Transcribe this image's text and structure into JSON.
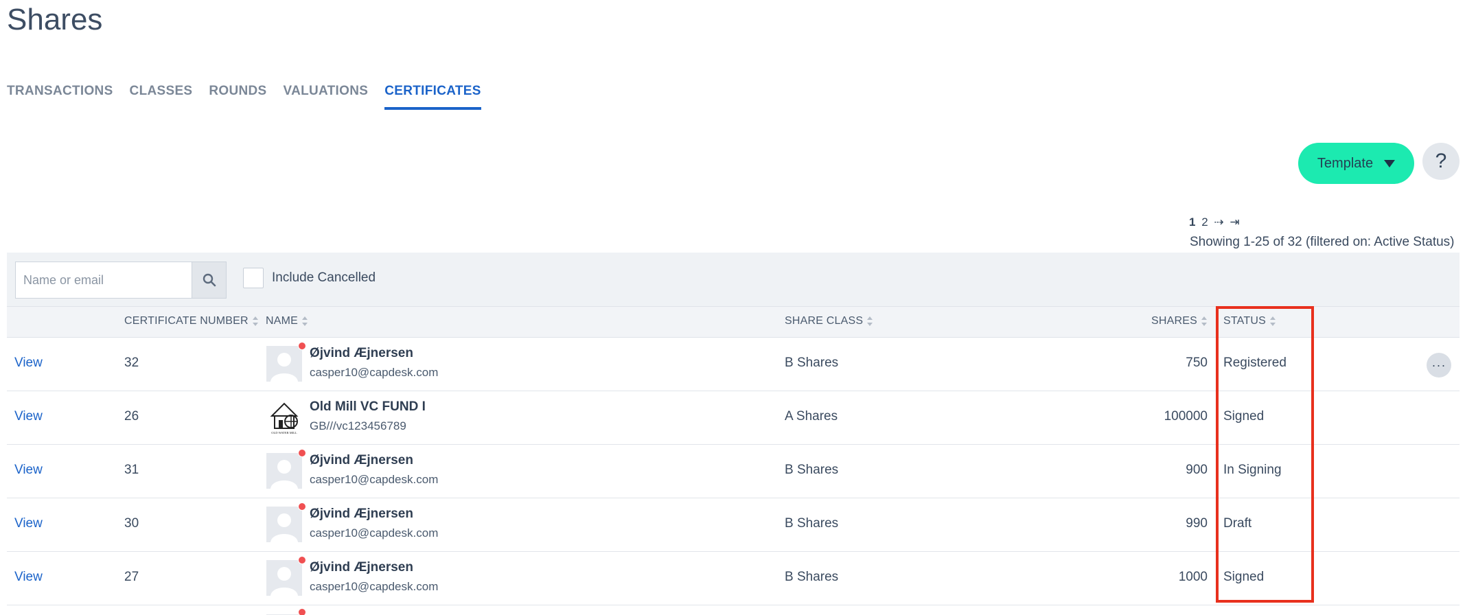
{
  "page": {
    "title": "Shares"
  },
  "tabs": [
    {
      "label": "TRANSACTIONS",
      "active": false
    },
    {
      "label": "CLASSES",
      "active": false
    },
    {
      "label": "ROUNDS",
      "active": false
    },
    {
      "label": "VALUATIONS",
      "active": false
    },
    {
      "label": "CERTIFICATES",
      "active": true
    }
  ],
  "toolbar": {
    "template_label": "Template",
    "help_label": "?"
  },
  "pagination": {
    "pages": [
      "1",
      "2"
    ],
    "current": "1",
    "next": "⇢",
    "last": "⇥",
    "summary": "Showing 1-25 of 32 (filtered on: Active Status)"
  },
  "filters": {
    "search_placeholder": "Name or email",
    "search_value": "",
    "include_cancelled_label": "Include Cancelled",
    "include_cancelled_checked": false
  },
  "table": {
    "columns": {
      "certificate_number": "CERTIFICATE NUMBER",
      "name": "NAME",
      "share_class": "SHARE CLASS",
      "shares": "SHARES",
      "status": "STATUS"
    },
    "rows": [
      {
        "action": "View",
        "certificate_number": "32",
        "name": "Øjvind Æjnersen",
        "sub": "casper10@capdesk.com",
        "avatar": "person-placeholder",
        "share_class": "B Shares",
        "shares": "750",
        "status": "Registered"
      },
      {
        "action": "View",
        "certificate_number": "26",
        "name": "Old Mill VC FUND I",
        "sub": "GB///vc123456789",
        "avatar": "old-water-mill-logo",
        "avatar_text": "OLD WATER MILL",
        "share_class": "A Shares",
        "shares": "100000",
        "status": "Signed"
      },
      {
        "action": "View",
        "certificate_number": "31",
        "name": "Øjvind Æjnersen",
        "sub": "casper10@capdesk.com",
        "avatar": "person-placeholder",
        "share_class": "B Shares",
        "shares": "900",
        "status": "In Signing"
      },
      {
        "action": "View",
        "certificate_number": "30",
        "name": "Øjvind Æjnersen",
        "sub": "casper10@capdesk.com",
        "avatar": "person-placeholder",
        "share_class": "B Shares",
        "shares": "990",
        "status": "Draft"
      },
      {
        "action": "View",
        "certificate_number": "27",
        "name": "Øjvind Æjnersen",
        "sub": "casper10@capdesk.com",
        "avatar": "person-placeholder",
        "share_class": "B Shares",
        "shares": "1000",
        "status": "Signed"
      }
    ],
    "row_menu_label": "···"
  },
  "colors": {
    "accent": "#1b63c9",
    "template_button": "#1ceab0",
    "highlight": "#e8301d",
    "notification_dot": "#f05052"
  }
}
